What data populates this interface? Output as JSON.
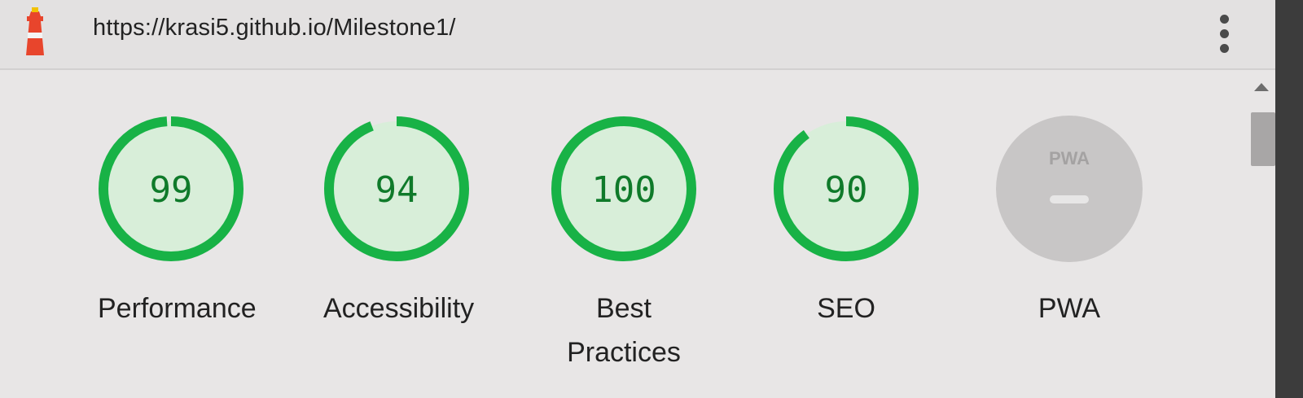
{
  "header": {
    "url": "https://krasi5.github.io/Milestone1/",
    "logo_icon": "lighthouse-icon",
    "menu_icon": "vertical-ellipsis-icon"
  },
  "colors": {
    "pass": "#18b246",
    "pass_fill": "#d8eed9",
    "score_text": "#0f7a2a",
    "na_fill": "#c8c6c6"
  },
  "gauges": [
    {
      "score": "99",
      "value": 99,
      "label": "Performance"
    },
    {
      "score": "94",
      "value": 94,
      "label": "Accessibility"
    },
    {
      "score": "100",
      "value": 100,
      "label": "Best Practices"
    },
    {
      "score": "90",
      "value": 90,
      "label": "SEO"
    }
  ],
  "pwa": {
    "badge_text": "PWA",
    "label": "PWA",
    "icon": "pwa-badge-icon"
  }
}
